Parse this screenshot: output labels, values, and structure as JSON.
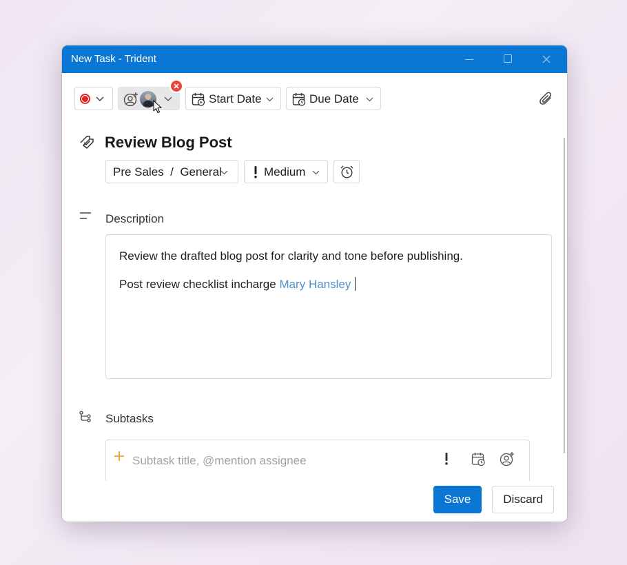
{
  "window": {
    "title": "New Task - Trident"
  },
  "toolbar": {
    "start_date_label": "Start Date",
    "due_date_label": "Due Date"
  },
  "task": {
    "title": "Review Blog Post",
    "project_label": "Pre Sales  /  General",
    "priority_label": "Medium"
  },
  "description": {
    "label": "Description",
    "line1": "Review the drafted blog post for clarity and tone before publishing.",
    "line2_prefix": "Post review checklist incharge ",
    "mention": "Mary Hansley"
  },
  "subtasks": {
    "label": "Subtasks",
    "placeholder": "Subtask title, @mention assignee"
  },
  "footer": {
    "save_label": "Save",
    "discard_label": "Discard"
  },
  "colors": {
    "accent": "#0b77d4",
    "status_dot": "#e02424",
    "remove_badge": "#e5473d",
    "mention": "#4f8fce",
    "subtask_plus": "#f0a030"
  },
  "icons": [
    "status-dot-icon",
    "chevron-down-icon",
    "add-person-icon",
    "avatar",
    "close-icon",
    "calendar-start-icon",
    "calendar-due-icon",
    "paperclip-icon",
    "task-tag-icon",
    "exclamation-icon",
    "alarm-clock-icon",
    "description-lines-icon",
    "subtask-tree-icon",
    "plus-icon",
    "calendar-clock-icon",
    "mouse-cursor-icon"
  ]
}
